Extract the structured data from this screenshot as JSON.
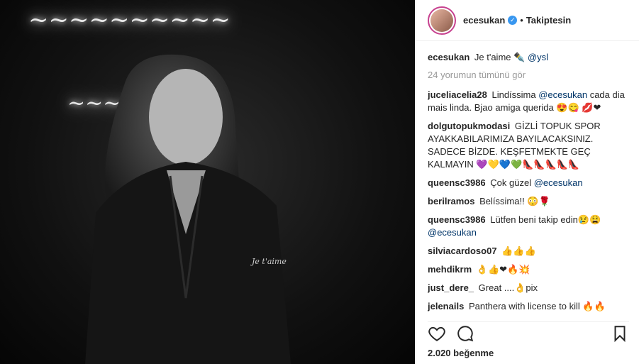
{
  "post": {
    "username": "ecesukan",
    "follow_status": "Takiptesin",
    "caption_text": "Je t'aime ✒️",
    "caption_mention": "@ysl",
    "view_all": "24 yorumun tümünü gör",
    "likes": "2.020 beğenme"
  },
  "comments": [
    {
      "user": "juceliacelia28",
      "text": "Lindíssima ",
      "mention": "@ecesukan",
      "after": " cada dia mais linda. Bjao amiga querida 😍😋 💋❤"
    },
    {
      "user": "dolgutopukmodasi",
      "text": "GİZLİ TOPUK SPOR AYAKKABILARIMIZA BAYILACAKSINIZ. SADECE BİZDE. KEŞFETMEKTE GEÇ KALMAYIN 💜💛💙💚👠👠👠👠👠",
      "mention": "",
      "after": ""
    },
    {
      "user": "queensc3986",
      "text": "Çok güzel ",
      "mention": "@ecesukan",
      "after": ""
    },
    {
      "user": "berilramos",
      "text": "Belíssima!! 😳🌹",
      "mention": "",
      "after": ""
    },
    {
      "user": "queensc3986",
      "text": "Lütfen beni takip edin😢😩 ",
      "mention": "@ecesukan",
      "after": ""
    },
    {
      "user": "silviacardoso07",
      "text": "👍👍👍",
      "mention": "",
      "after": ""
    },
    {
      "user": "mehdikrm",
      "text": "👌👍❤🔥💥",
      "mention": "",
      "after": ""
    },
    {
      "user": "just_dere_",
      "text": "Great ....👌pix",
      "mention": "",
      "after": ""
    },
    {
      "user": "jelenails",
      "text": "Panthera with license to kill 🔥🔥",
      "mention": "",
      "after": ""
    }
  ],
  "icons": [
    "like-icon",
    "comment-icon",
    "save-icon",
    "verified-icon"
  ]
}
